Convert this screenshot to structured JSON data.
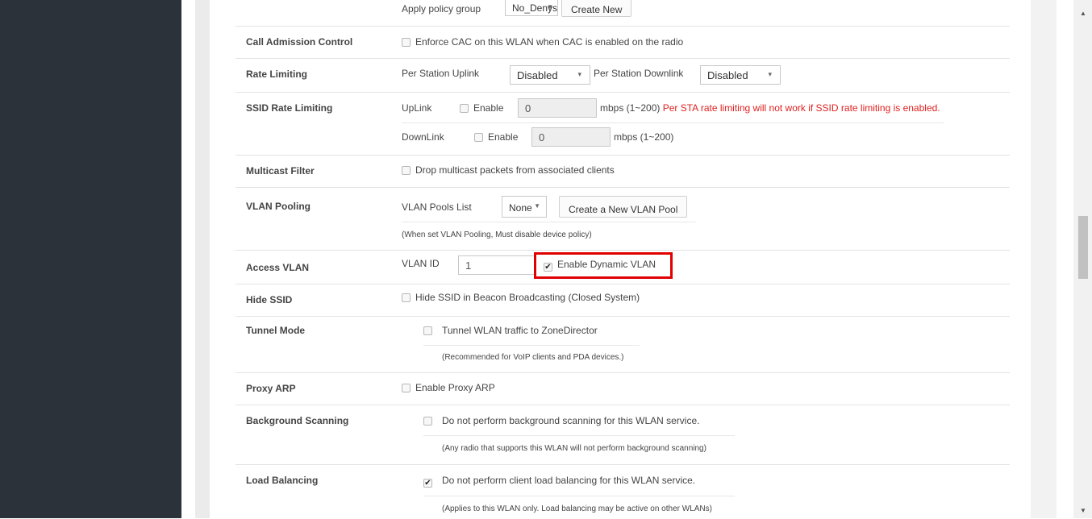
{
  "scroll": {
    "up_arrow": "▲",
    "down_arrow": "▼"
  },
  "policy": {
    "label": "Apply policy group",
    "select_value": "No_Denys",
    "create_button": "Create New"
  },
  "cac": {
    "label": "Call Admission Control",
    "checkbox_label": "Enforce CAC on this WLAN when CAC is enabled on the radio",
    "checked": false
  },
  "rate_limiting": {
    "label": "Rate Limiting",
    "uplink_label": "Per Station Uplink",
    "uplink_value": "Disabled",
    "downlink_label": "Per Station Downlink",
    "downlink_value": "Disabled"
  },
  "ssid_rate": {
    "label": "SSID Rate Limiting",
    "uplink_label": "UpLink",
    "uplink_enable": "Enable",
    "uplink_value": "0",
    "uplink_unit": "mbps (1~200)",
    "warning": "Per STA rate limiting will not work if SSID rate limiting is enabled.",
    "downlink_label": "DownLink",
    "downlink_enable": "Enable",
    "downlink_value": "0",
    "downlink_unit": "mbps (1~200)"
  },
  "multicast": {
    "label": "Multicast Filter",
    "checkbox_label": "Drop multicast packets from associated clients",
    "checked": false
  },
  "vlan_pooling": {
    "label": "VLAN Pooling",
    "list_label": "VLAN Pools List",
    "select_value": "None",
    "create_button": "Create a New VLAN Pool",
    "note": "(When set VLAN Pooling, Must disable device policy)"
  },
  "access_vlan": {
    "label": "Access VLAN",
    "vlan_id_label": "VLAN ID",
    "vlan_id_value": "1",
    "dynamic_label": "Enable Dynamic VLAN",
    "dynamic_checked": true
  },
  "hide_ssid": {
    "label": "Hide SSID",
    "checkbox_label": "Hide SSID in Beacon Broadcasting (Closed System)",
    "checked": false
  },
  "tunnel": {
    "label": "Tunnel Mode",
    "checkbox_label": "Tunnel WLAN traffic to ZoneDirector",
    "note": "(Recommended for VoIP clients and PDA devices.)",
    "checked": false
  },
  "proxy_arp": {
    "label": "Proxy ARP",
    "checkbox_label": "Enable Proxy ARP",
    "checked": false
  },
  "bg_scan": {
    "label": "Background Scanning",
    "checkbox_label": "Do not perform background scanning for this WLAN service.",
    "note": "(Any radio that supports this WLAN will not perform background scanning)",
    "checked": false
  },
  "load_balancing": {
    "label": "Load Balancing",
    "checkbox_label": "Do not perform client load balancing for this WLAN service.",
    "note": "(Applies to this WLAN only. Load balancing may be active on other WLANs)",
    "checked": true
  },
  "icons": {
    "check": "✔",
    "caret_down": "▾",
    "caret_down_solid": "▼"
  },
  "colors": {
    "sidebar": "#2b3239",
    "warning": "#e02020",
    "highlight": "#e00000"
  }
}
